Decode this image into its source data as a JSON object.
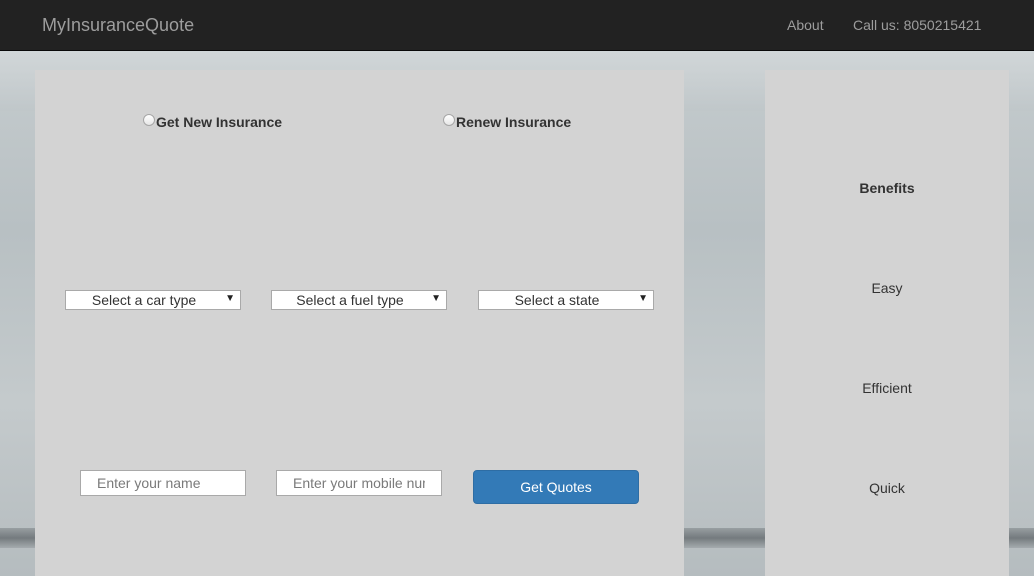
{
  "navbar": {
    "brand": "MyInsuranceQuote",
    "links": [
      {
        "label": "About"
      },
      {
        "label": "Call us: 8050215421"
      }
    ]
  },
  "form": {
    "radios": [
      {
        "label": "Get New Insurance",
        "checked": false
      },
      {
        "label": "Renew Insurance",
        "checked": false
      }
    ],
    "selects": [
      {
        "selected": "Select a car type"
      },
      {
        "selected": "Select a fuel type"
      },
      {
        "selected": "Select a state"
      }
    ],
    "name_placeholder": "Enter your name",
    "mobile_placeholder": "Enter your mobile number",
    "submit_label": "Get Quotes"
  },
  "benefits": {
    "title": "Benefits",
    "items": [
      "Easy",
      "Efficient",
      "Quick"
    ]
  },
  "colors": {
    "navbar": "#222222",
    "panel": "#d3d3d3",
    "primary_button": "#337ab7"
  }
}
